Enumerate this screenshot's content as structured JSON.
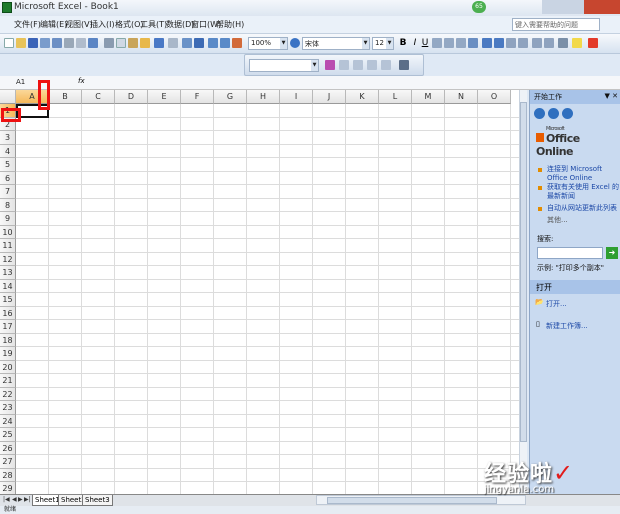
{
  "window": {
    "title": "Microsoft Excel - Book1",
    "notification_count": "65"
  },
  "menu": {
    "items": [
      "文件(F)",
      "编辑(E)",
      "视图(V)",
      "插入(I)",
      "格式(O)",
      "工具(T)",
      "数据(D)",
      "窗口(W)",
      "帮助(H)"
    ],
    "help_placeholder": "键入需要帮助的问题"
  },
  "toolbar": {
    "zoom": "100%",
    "font_name": "宋体",
    "font_size": "12"
  },
  "formula_bar": {
    "name_box": "A1",
    "fx": "fx"
  },
  "grid": {
    "columns": [
      "A",
      "B",
      "C",
      "D",
      "E",
      "F",
      "G",
      "H",
      "I",
      "J",
      "K",
      "L",
      "M",
      "N",
      "O"
    ],
    "rows": [
      "1",
      "2",
      "3",
      "4",
      "5",
      "6",
      "7",
      "8",
      "9",
      "10",
      "11",
      "12",
      "13",
      "14",
      "15",
      "16",
      "17",
      "18",
      "19",
      "20",
      "21",
      "22",
      "23",
      "24",
      "25",
      "26",
      "27",
      "28",
      "29"
    ]
  },
  "task_pane": {
    "title": "开始工作",
    "brand_small": "Microsoft",
    "brand": "Office Online",
    "links": [
      "连接到 Microsoft Office Online",
      "获取有关使用 Excel 的最新新闻",
      "自动从网站更新此列表"
    ],
    "more": "其他...",
    "search_label": "搜索:",
    "example": "示例:  \"打印多个副本\"",
    "open_section": "打开",
    "open_link": "打开...",
    "new_workbook": "新建工作簿..."
  },
  "sheets": [
    "Sheet1",
    "Sheet2",
    "Sheet3"
  ],
  "status": {
    "left": "就绪"
  },
  "watermark": {
    "text": "经验啦",
    "url": "jingyanla.com"
  }
}
